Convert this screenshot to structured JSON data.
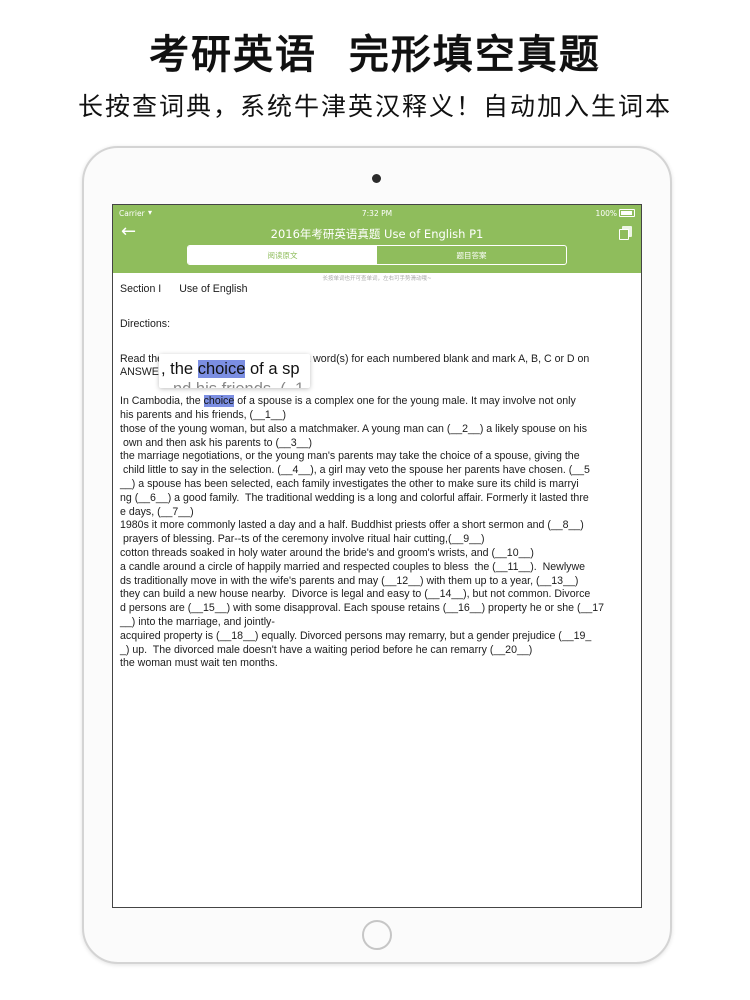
{
  "promo": {
    "title": "考研英语  完形填空真题",
    "subtitle": "长按查词典，系统牛津英汉释义！自动加入生词本"
  },
  "status_bar": {
    "carrier": "Carrier",
    "time": "7:32 PM",
    "battery": "100%"
  },
  "nav": {
    "title": "2016年考研英语真题 Use of English P1",
    "back_icon": "back-arrow-icon",
    "copy_icon": "copy-icon"
  },
  "tabs": [
    {
      "label": "阅读原文",
      "active": true
    },
    {
      "label": "题目答案",
      "active": false
    }
  ],
  "hint": "长按单词也开可查单词，左右可手势滑动哦~",
  "magnifier": {
    "before": ", the ",
    "word": "choice",
    "after": " of a sp",
    "ghost": "nd his friends, (_1"
  },
  "content": {
    "section": "Section I",
    "section_title": "Use of English",
    "directions": "Directions:",
    "instructions": "Read the following text. Choose the best word(s) for each numbered blank and mark A, B, C or D on ANSWER SHEET.",
    "line1_before": "In Cambodia, the ",
    "line1_word": "choice",
    "line1_after": " of a spouse is a complex one for the young male. It may involve not only",
    "lines": [
      "his parents and his friends, (__1__)",
      "those of the young woman, but also a matchmaker. A young man can (__2__) a likely spouse on his",
      " own and then ask his parents to (__3__)",
      "the marriage negotiations, or the young man's parents may take the choice of a spouse, giving the",
      " child little to say in the selection. (__4__), a girl may veto the spouse her parents have chosen. (__5",
      "__) a spouse has been selected, each family investigates the other to make sure its child is marryi",
      "ng (__6__) a good family.  The traditional wedding is a long and colorful affair. Formerly it lasted thre",
      "e days, (__7__)",
      "1980s it more commonly lasted a day and a half. Buddhist priests offer a short sermon and (__8__)",
      " prayers of blessing. Par--ts of the ceremony involve ritual hair cutting,(__9__)",
      "cotton threads soaked in holy water around the bride's and groom's wrists, and (__10__)",
      "a candle around a circle of happily married and respected couples to bless  the (__11__).  Newlywe",
      "ds traditionally move in with the wife's parents and may (__12__) with them up to a year, (__13__)",
      "they can build a new house nearby.  Divorce is legal and easy to (__14__), but not common. Divorce",
      "d persons are (__15__) with some disapproval. Each spouse retains (__16__) property he or she (__17",
      "__) into the marriage, and jointly-",
      "acquired property is (__18__) equally. Divorced persons may remarry, but a gender prejudice (__19_",
      "_) up.  The divorced male doesn't have a waiting period before he can remarry (__20__)",
      "the woman must wait ten months."
    ]
  }
}
